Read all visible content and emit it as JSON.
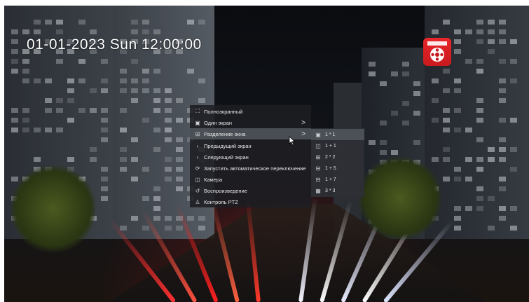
{
  "overlay": {
    "timestamp": "01-01-2023 Sun 12:00:00"
  },
  "context_menu": {
    "items": [
      {
        "label": "Полноэкранный",
        "icon": "fullscreen-icon"
      },
      {
        "label": "Один экран",
        "icon": "single-screen-icon",
        "has_submenu": true
      },
      {
        "label": "Разделение окна",
        "icon": "split-window-icon",
        "has_submenu": true,
        "active": true
      },
      {
        "label": "Предыдущий экран",
        "icon": "chevron-left-icon"
      },
      {
        "label": "Следующий экран",
        "icon": "chevron-right-icon"
      },
      {
        "label": "Запустить автоматическое переключение",
        "icon": "auto-switch-icon"
      },
      {
        "label": "Камера",
        "icon": "camera-icon"
      },
      {
        "label": "Воспроизведение",
        "icon": "playback-icon"
      },
      {
        "label": "Контроль PTZ",
        "icon": "ptz-icon"
      }
    ],
    "submenu_arrow": ">"
  },
  "split_submenu": {
    "items": [
      {
        "label": "1 * 1",
        "icon": "layout-1x1-icon",
        "active": true
      },
      {
        "label": "1 + 1",
        "icon": "layout-1plus1-icon"
      },
      {
        "label": "2 * 2",
        "icon": "layout-2x2-icon"
      },
      {
        "label": "1 + 5",
        "icon": "layout-1plus5-icon"
      },
      {
        "label": "1 + 7",
        "icon": "layout-1plus7-icon"
      },
      {
        "label": "3 * 3",
        "icon": "layout-3x3-icon"
      }
    ]
  },
  "colors": {
    "menu_bg": "#1c1e22",
    "menu_active": "#5a5f66",
    "logo_red": "#e8262a"
  }
}
